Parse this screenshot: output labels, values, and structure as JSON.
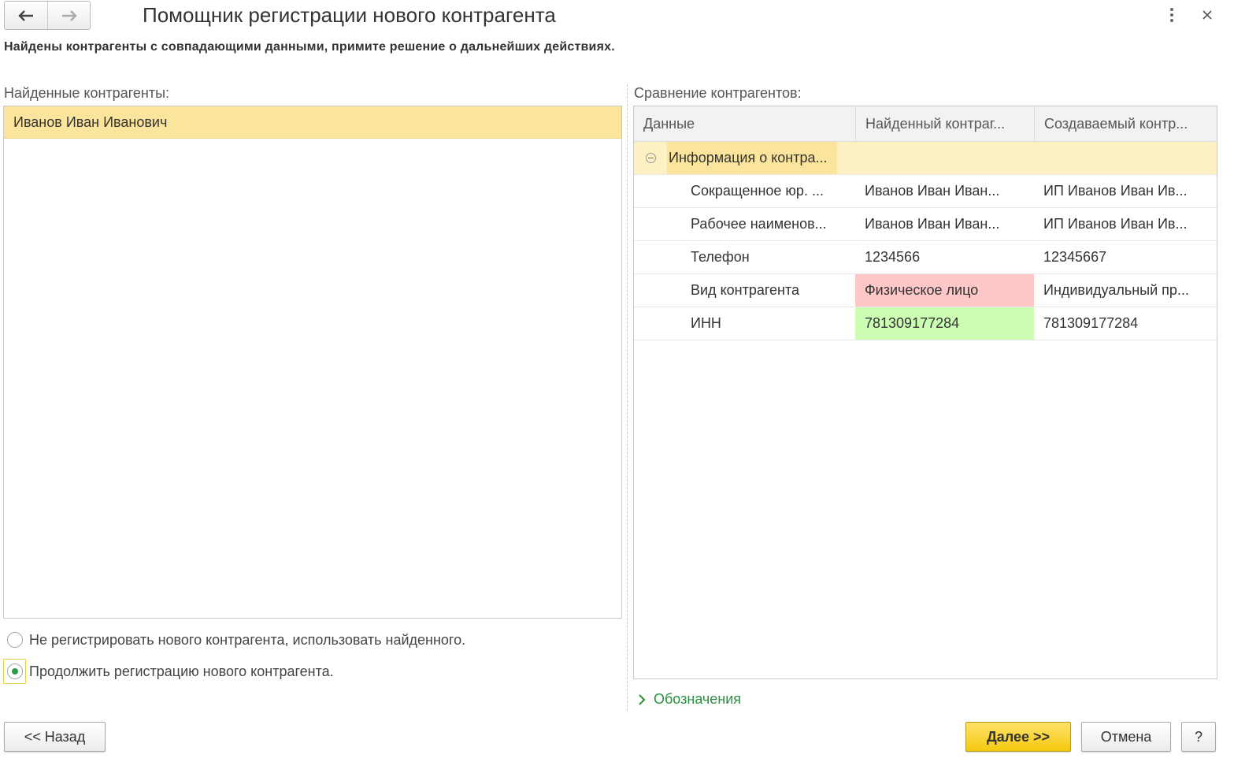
{
  "window": {
    "title": "Помощник регистрации нового контрагента",
    "subtitle": "Найдены контрагенты с совпадающими данными, примите решение о дальнейших действиях."
  },
  "found": {
    "label": "Найденные контрагенты:",
    "items": [
      "Иванов Иван Иванович"
    ]
  },
  "options": {
    "use_found": "Не регистрировать нового контрагента, использовать найденного.",
    "continue_new": "Продолжить регистрацию нового контрагента.",
    "selected": "continue_new"
  },
  "comparison": {
    "label": "Сравнение контрагентов:",
    "columns": [
      "Данные",
      "Найденный контраг...",
      "Создаваемый контр..."
    ],
    "group": "Информация о контра...",
    "rows": [
      {
        "field": "Сокращенное юр. ...",
        "found": "Иванов Иван Иван...",
        "new": "ИП Иванов Иван Ив...",
        "status": "none"
      },
      {
        "field": "Рабочее наименов...",
        "found": "Иванов Иван Иван...",
        "new": "ИП Иванов Иван Ив...",
        "status": "none"
      },
      {
        "field": "Телефон",
        "found": "1234566",
        "new": "12345667",
        "status": "none"
      },
      {
        "field": "Вид контрагента",
        "found": "Физическое лицо",
        "new": "Индивидуальный пр...",
        "status": "different"
      },
      {
        "field": "ИНН",
        "found": "781309177284",
        "new": "781309177284",
        "status": "match"
      }
    ]
  },
  "legend_link": "Обозначения",
  "buttons": {
    "back": "<< Назад",
    "next": "Далее >>",
    "cancel": "Отмена",
    "help": "?"
  },
  "colors": {
    "selected_row": "#fbe59c",
    "different": "#ffc7c7",
    "match": "#ccffb3",
    "primary_button": "#f5c90f",
    "link": "#2a8f3e"
  }
}
